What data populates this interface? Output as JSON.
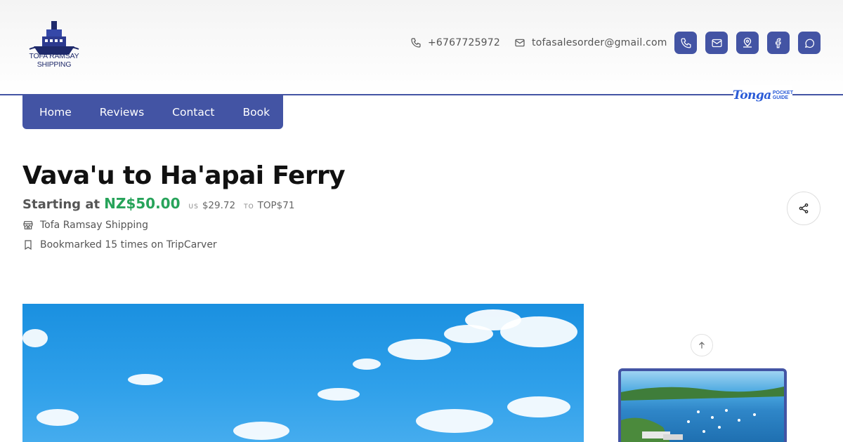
{
  "header": {
    "logo_line1": "TOFA RAMSAY",
    "logo_line2": "SHIPPING",
    "phone": "+6767725972",
    "email": "tofasalesorder@gmail.com",
    "social_icons": [
      "phone-icon",
      "mail-icon",
      "map-pin-icon",
      "facebook-icon",
      "whatsapp-icon"
    ],
    "brand_name": "Tonga",
    "brand_tag_1": "POCKET",
    "brand_tag_2": "GUIDE"
  },
  "nav": {
    "items": [
      "Home",
      "Reviews",
      "Contact",
      "Book"
    ]
  },
  "listing": {
    "title": "Vava'u to Ha'apai Ferry",
    "price_label": "Starting at",
    "price_main": "NZ$50.00",
    "price_usd_flag": "US",
    "price_usd": "$29.72",
    "price_top_flag": "TO",
    "price_top": "TOP$71",
    "company": "Tofa Ramsay Shipping",
    "bookmarks": "Bookmarked 15 times on TripCarver"
  },
  "colors": {
    "brand": "#4354a4",
    "price": "#27a35a"
  }
}
